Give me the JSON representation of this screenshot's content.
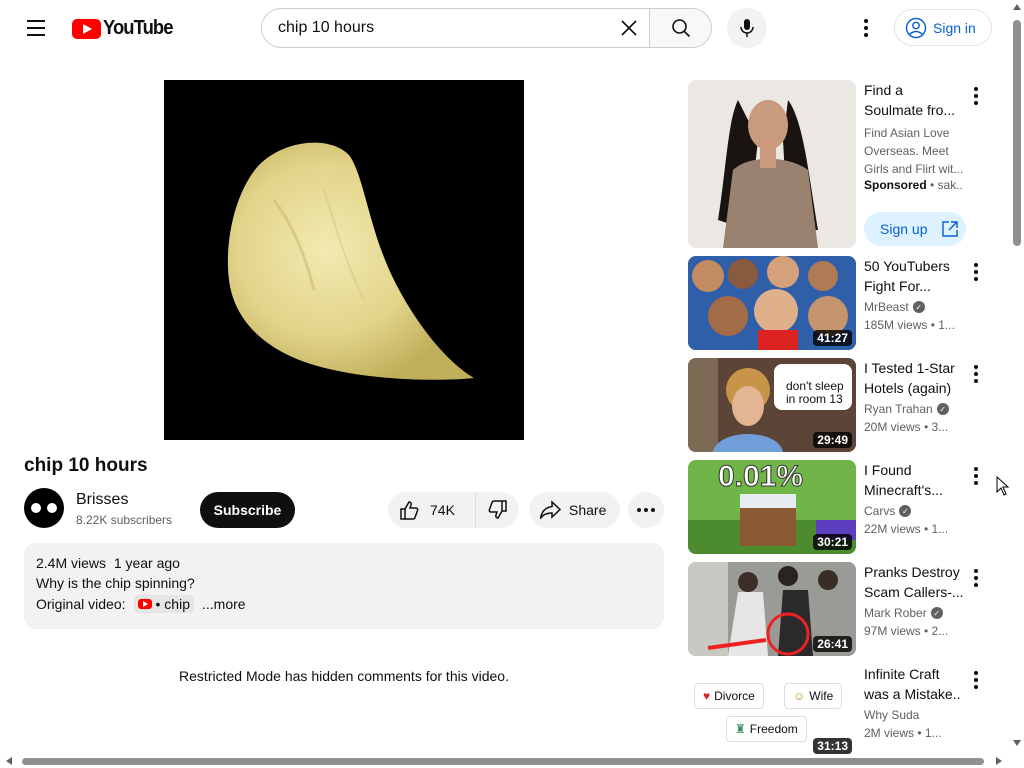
{
  "header": {
    "logo_text": "YouTube",
    "search_value": "chip 10 hours",
    "signin_label": "Sign in"
  },
  "video": {
    "title": "chip 10 hours",
    "channel": "Brisses",
    "subscribers": "8.22K subscribers",
    "subscribe_label": "Subscribe",
    "likes": "74K",
    "share_label": "Share"
  },
  "description": {
    "views": "2.4M views",
    "age": "1 year ago",
    "text": "Why is the chip spinning?",
    "original_label": "Original video:",
    "link_text": "• chip",
    "more_label": "...more"
  },
  "comments": {
    "restricted_text": "Restricted Mode has hidden comments for this video."
  },
  "sidebar": {
    "ad": {
      "title": "Find a Soulmate fro...",
      "description": "Find Asian Love Overseas. Meet Girls and Flirt wit...",
      "sponsored_label": "Sponsored",
      "sponsor": " • sak...",
      "signup_label": "Sign up"
    },
    "items": [
      {
        "title": "50 YouTubers Fight For...",
        "channel": "MrBeast",
        "verified": true,
        "meta": "185M views • 1...",
        "duration": "41:27"
      },
      {
        "title": "I Tested 1-Star Hotels (again)",
        "channel": "Ryan Trahan",
        "verified": true,
        "meta": "20M views • 3...",
        "duration": "29:49",
        "thumb_text_1": "don't sleep",
        "thumb_text_2": "in room 13"
      },
      {
        "title": "I Found Minecraft's...",
        "channel": "Carvs",
        "verified": true,
        "meta": "22M views • 1...",
        "duration": "30:21",
        "thumb_text": "0.01%"
      },
      {
        "title": "Pranks Destroy Scam Callers-...",
        "channel": "Mark Rober",
        "verified": true,
        "meta": "97M views • 2...",
        "duration": "26:41"
      },
      {
        "title": "Infinite Craft was a Mistake..",
        "channel": "Why Suda",
        "verified": false,
        "meta": "2M views • 1...",
        "duration": "31:13",
        "tags": [
          "Divorce",
          "Wife",
          "Freedom"
        ]
      }
    ]
  },
  "colors": {
    "brand_red": "#ff0000",
    "link_blue": "#065fd4",
    "chip_bg": "#f2f2f2"
  }
}
